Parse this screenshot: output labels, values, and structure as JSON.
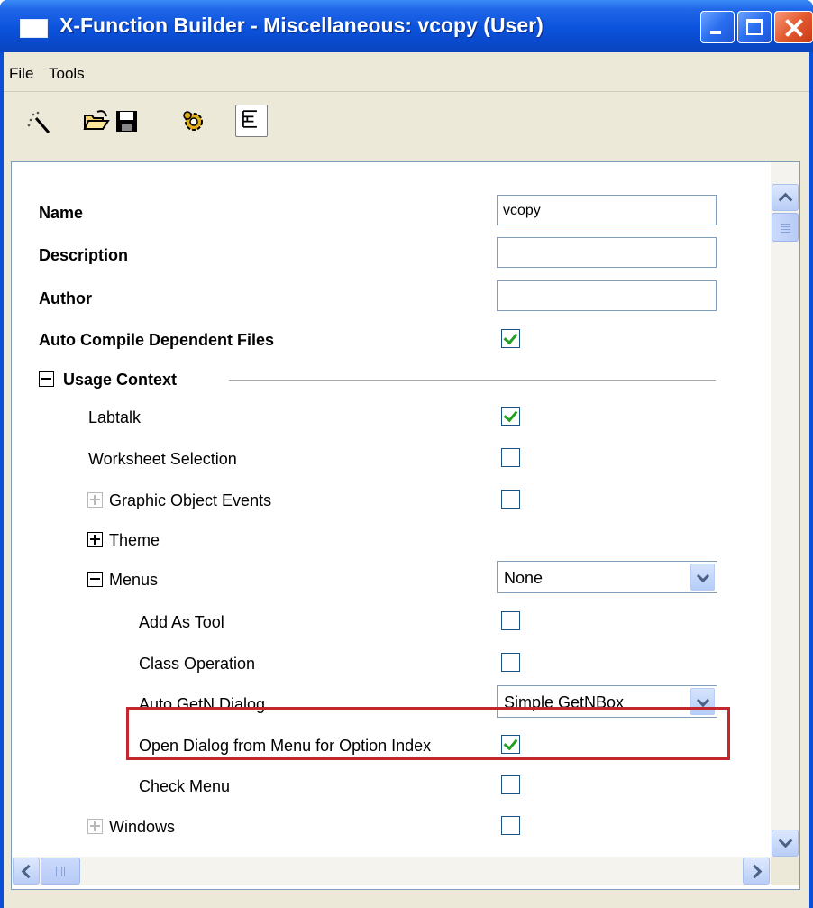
{
  "window": {
    "title": "X-Function Builder - Miscellaneous: vcopy (User)"
  },
  "menubar": {
    "items": [
      "File",
      "Tools"
    ]
  },
  "toolbar": {
    "icons": [
      "new-wand-icon",
      "open-folder-icon",
      "save-icon",
      "compile-gear-icon",
      "tree-view-icon"
    ]
  },
  "properties": {
    "name": {
      "label": "Name",
      "value": "vcopy"
    },
    "description": {
      "label": "Description",
      "value": ""
    },
    "author": {
      "label": "Author",
      "value": ""
    },
    "auto_compile": {
      "label": "Auto Compile Dependent Files",
      "checked": true
    },
    "usage_context": {
      "label": "Usage Context",
      "expanded": true,
      "labtalk": {
        "label": "Labtalk",
        "checked": true
      },
      "worksheet_selection": {
        "label": "Worksheet Selection",
        "checked": false
      },
      "graphic_object_events": {
        "label": "Graphic Object Events",
        "checked": false
      },
      "theme": {
        "label": "Theme",
        "expanded": false
      },
      "menus": {
        "label": "Menus",
        "expanded": true,
        "value": "None",
        "add_as_tool": {
          "label": "Add As Tool",
          "checked": false
        },
        "class_operation": {
          "label": "Class Operation",
          "checked": false
        },
        "auto_getn_dialog": {
          "label": "Auto GetN Dialog",
          "value": "Simple GetNBox"
        },
        "open_dialog_from_menu": {
          "label": "Open Dialog from Menu for Option Index",
          "checked": true
        },
        "check_menu": {
          "label": "Check Menu",
          "checked": false
        }
      },
      "windows": {
        "label": "Windows",
        "checked": false
      }
    }
  },
  "colors": {
    "titlebar": "#0b52dc",
    "client_bg": "#ece9d8",
    "highlight_border": "#c1272d",
    "checkmark": "#21a121"
  }
}
